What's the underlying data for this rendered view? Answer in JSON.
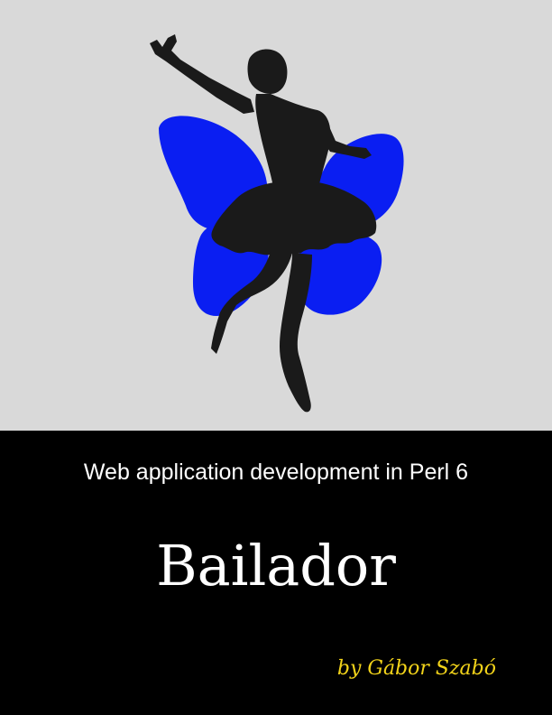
{
  "cover": {
    "subtitle": "Web application development in Perl 6",
    "title": "Bailador",
    "author": "by Gábor Szabó"
  },
  "colors": {
    "art_background": "#d9d9d9",
    "text_background": "#000000",
    "wings": "#0a1ef2",
    "silhouette": "#1a1a1a",
    "title_text": "#ffffff",
    "author_text": "#f2d31a"
  },
  "artwork": {
    "description_icon": "butterfly-dancer-silhouette-icon"
  }
}
